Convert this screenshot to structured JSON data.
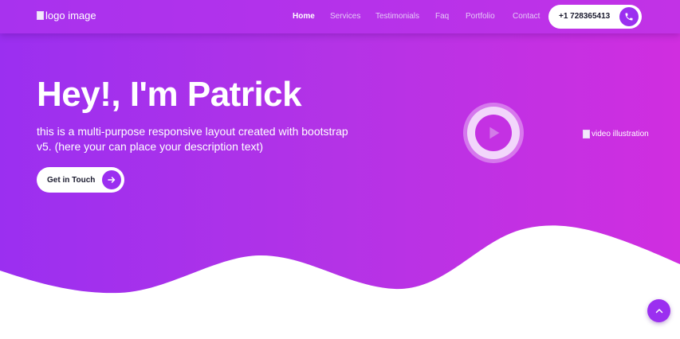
{
  "nav": {
    "logo_alt": "logo image",
    "items": [
      {
        "label": "Home",
        "active": true
      },
      {
        "label": "Services",
        "active": false
      },
      {
        "label": "Testimonials",
        "active": false
      },
      {
        "label": "Faq",
        "active": false
      },
      {
        "label": "Portfolio",
        "active": false
      },
      {
        "label": "Contact",
        "active": false
      }
    ],
    "phone": "+1 728365413",
    "phone_icon": "phone-icon"
  },
  "hero": {
    "title": "Hey!, I'm Patrick",
    "description": "this is a multi-purpose responsive layout created with bootstrap v5. (here your can place your description text)",
    "cta_label": "Get in Touch",
    "cta_icon": "arrow-right-icon",
    "play_icon": "play-icon",
    "video_alt": "video illustration"
  },
  "scroll_top_icon": "chevron-up-icon",
  "colors": {
    "gradient_start": "#9b2ff0",
    "gradient_end": "#d02ee0",
    "accent": "#9b2ff0",
    "text_dark": "#1a1a2e"
  }
}
